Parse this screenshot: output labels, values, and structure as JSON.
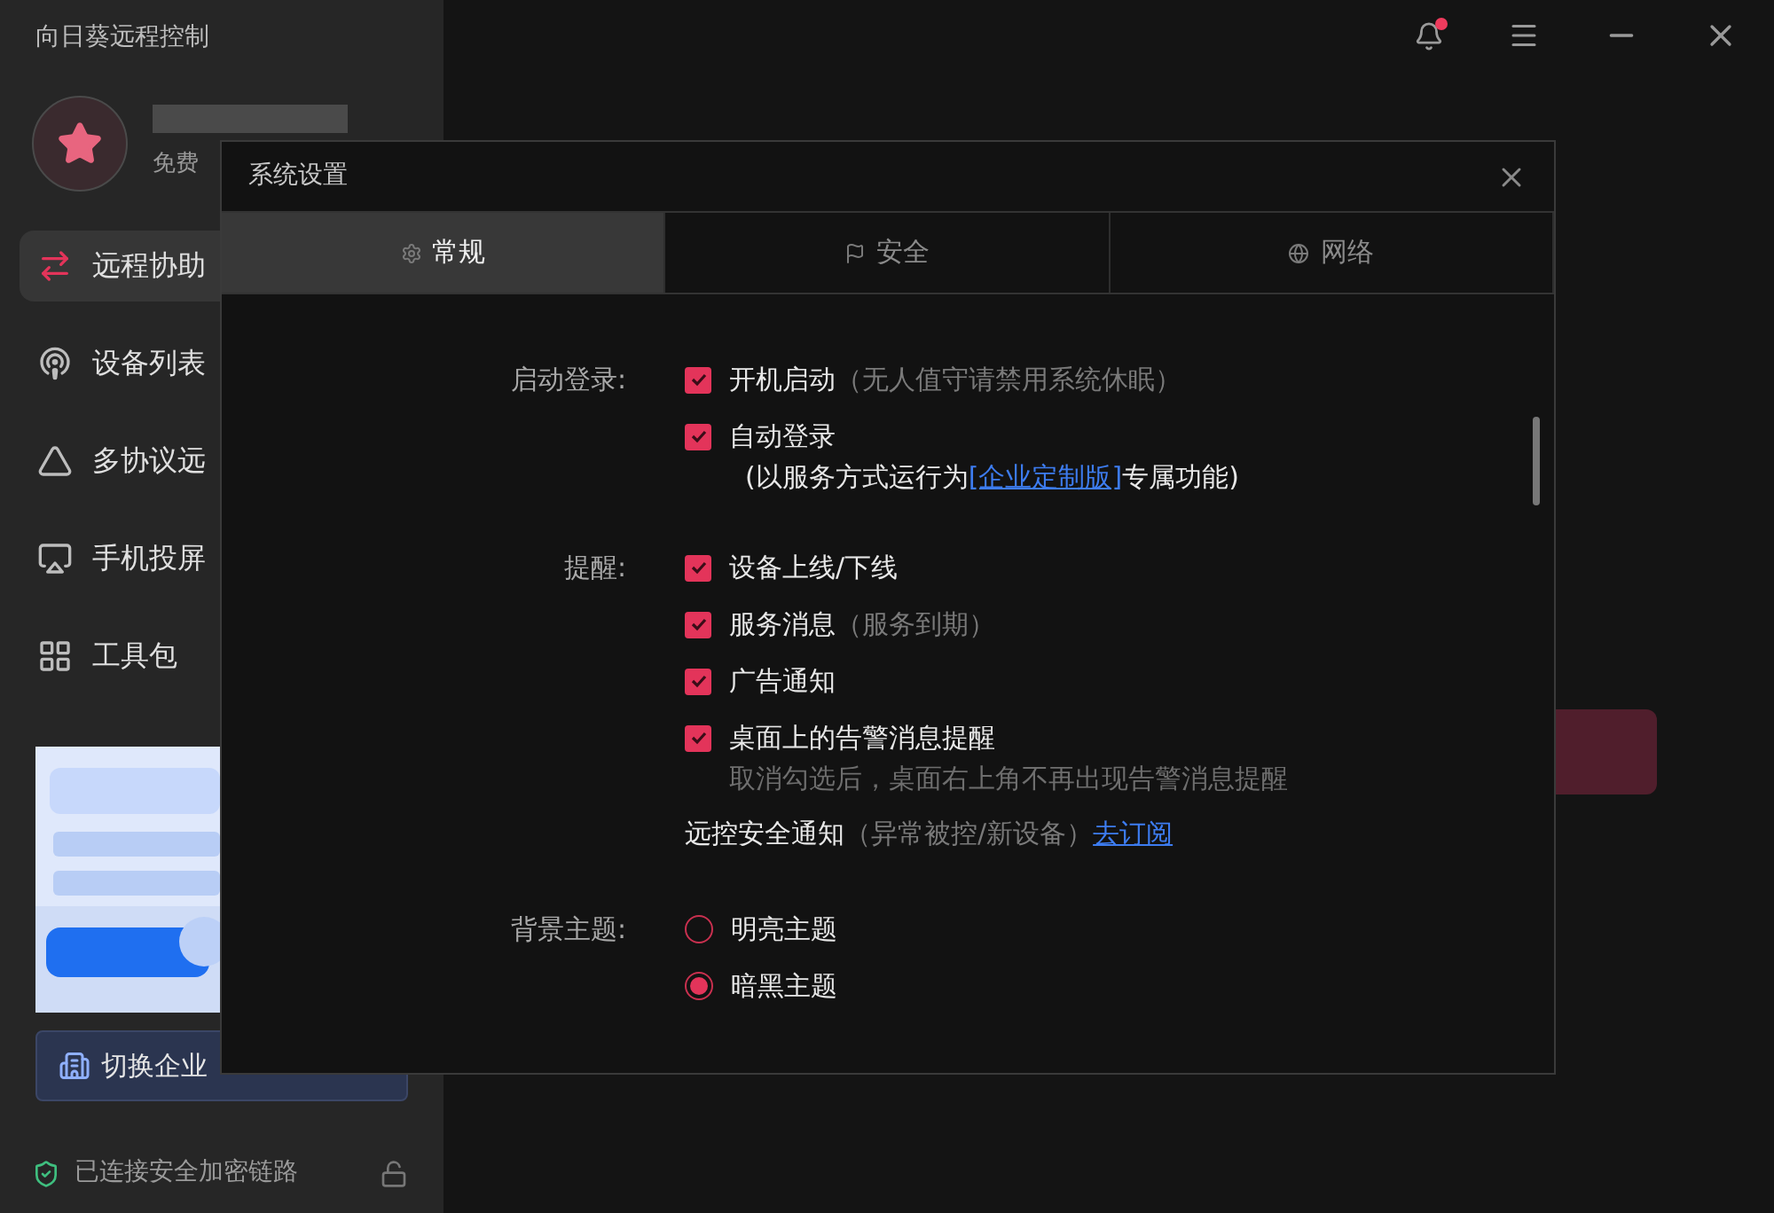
{
  "app": {
    "title": "向日葵远程控制",
    "plan": "免费"
  },
  "sidebar": {
    "items": [
      {
        "label": "远程协助",
        "selected": true
      },
      {
        "label": "设备列表",
        "selected": false
      },
      {
        "label": "多协议远",
        "selected": false
      },
      {
        "label": "手机投屏",
        "selected": false
      },
      {
        "label": "工具包",
        "selected": false
      }
    ],
    "switch_button": "切换企业",
    "status": "已连接安全加密链路"
  },
  "dialog": {
    "title": "系统设置",
    "tabs": [
      {
        "label": "常规",
        "selected": true
      },
      {
        "label": "安全",
        "selected": false
      },
      {
        "label": "网络",
        "selected": false
      }
    ],
    "sections": [
      {
        "label": "启动登录:",
        "items": [
          {
            "kind": "checkbox",
            "label": "开机启动",
            "hint": "（无人值守请禁用系统休眠）",
            "checked": true
          },
          {
            "kind": "checkbox",
            "label": "自动登录",
            "checked": true,
            "note_before": "(以服务方式运行为",
            "note_link": "[企业定制版]",
            "note_after": "专属功能)"
          }
        ]
      },
      {
        "label": "提醒:",
        "items": [
          {
            "kind": "checkbox",
            "label": "设备上线/下线",
            "checked": true
          },
          {
            "kind": "checkbox",
            "label": "服务消息",
            "hint": "（服务到期）",
            "checked": true
          },
          {
            "kind": "checkbox",
            "label": "广告通知",
            "checked": true
          },
          {
            "kind": "checkbox",
            "label": "桌面上的告警消息提醒",
            "checked": true,
            "note": "取消勾选后，桌面右上角不再出现告警消息提醒"
          },
          {
            "kind": "text",
            "label": "远控安全通知",
            "hint": "（异常被控/新设备）",
            "link": "去订阅"
          }
        ]
      },
      {
        "label": "背景主题:",
        "items": [
          {
            "kind": "radio",
            "label": "明亮主题",
            "selected": false
          },
          {
            "kind": "radio",
            "label": "暗黑主题",
            "selected": true
          }
        ]
      }
    ]
  }
}
